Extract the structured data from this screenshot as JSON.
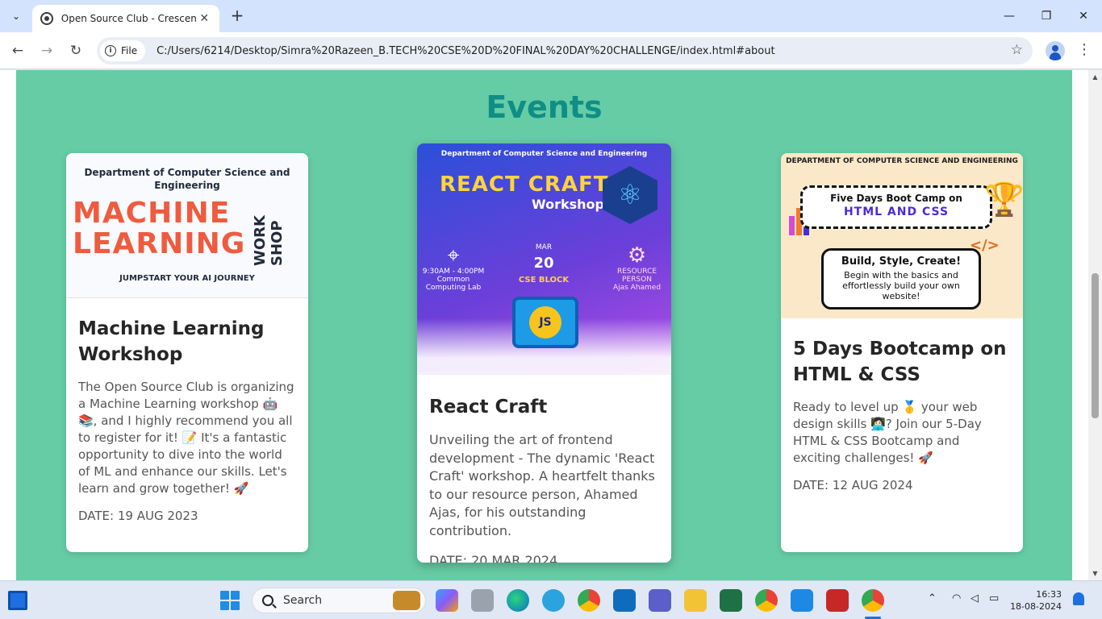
{
  "browser": {
    "tab_title": "Open Source Club - Crescent C",
    "chip_label": "File",
    "url": "C:/Users/6214/Desktop/Simra%20Razeen_B.TECH%20CSE%20D%20FINAL%20DAY%20CHALLENGE/index.html#about"
  },
  "page": {
    "section_title": "Events",
    "cards": [
      {
        "title": "Machine Learning Workshop",
        "description": "The Open Source Club is organizing a Machine Learning workshop 🤖📚, and I highly recommend you all to register for it! 📝 It's a fantastic opportunity to dive into the world of ML and enhance our skills. Let's learn and grow together! 🚀",
        "date": "DATE: 19 AUG 2023",
        "poster": {
          "dept": "Department of Computer Science and Engineering",
          "line1": "MACHINE",
          "line2": "LEARNING",
          "side": "WORK SHOP",
          "tagline": "JUMPSTART YOUR AI JOURNEY"
        }
      },
      {
        "title": "React Craft",
        "description": "Unveiling the art of frontend development - The dynamic 'React Craft' workshop. A heartfelt thanks to our resource person, Ahamed Ajas, for his outstanding contribution.",
        "date": "DATE: 20 MAR 2024",
        "poster": {
          "dept": "Department of Computer Science and Engineering",
          "title": "REACT CRAFT",
          "subtitle": "Workshop",
          "time": "9:30AM - 4:00PM",
          "venue": "Common Computing Lab",
          "month": "MAR",
          "day": "20",
          "block": "CSE BLOCK",
          "rp_label": "RESOURCE PERSON",
          "rp_name": "Ajas Ahamed",
          "badge": "JS"
        }
      },
      {
        "title": "5 Days Bootcamp on HTML & CSS",
        "description": "Ready to level up 🥇 your web design skills 👩🏻‍💻? Join our 5-Day HTML & CSS Bootcamp and exciting challenges! 🚀",
        "date": "DATE: 12 AUG 2024",
        "poster": {
          "dept": "DEPARTMENT OF COMPUTER SCIENCE AND ENGINEERING",
          "box1_line1": "Five Days Boot Camp on",
          "box1_line2": "HTML AND CSS",
          "box2_line1": "Build, Style, Create!",
          "box2_line2": "Begin with the basics and effortlessly build your own website!",
          "code": "</>"
        }
      }
    ]
  },
  "taskbar": {
    "search_label": "Search",
    "time": "16:33",
    "date": "18-08-2024"
  },
  "colors": {
    "section_bg": "#66cca6",
    "title": "#0f8e85",
    "ml_accent": "#ef5b3e",
    "react_yellow": "#ffd33d"
  }
}
